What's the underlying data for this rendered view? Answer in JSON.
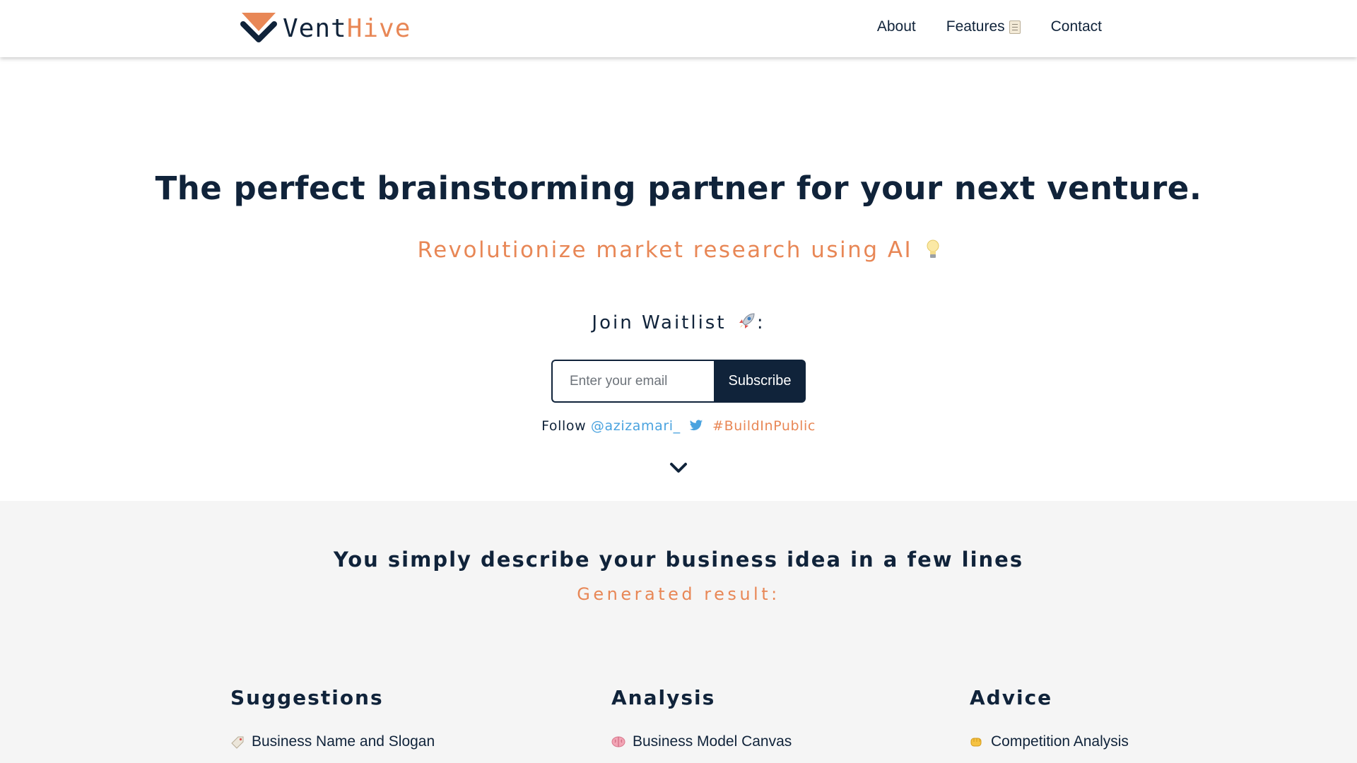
{
  "brand": {
    "name_part1": "Vent",
    "name_part2": "Hive",
    "primary_color": "#10233a",
    "accent_color": "#e88756"
  },
  "nav": {
    "items": [
      {
        "label": "About"
      },
      {
        "label": "Features",
        "icon": "memo-icon"
      },
      {
        "label": "Contact"
      }
    ]
  },
  "hero": {
    "title": "The perfect brainstorming partner for your next venture.",
    "subtitle": "Revolutionize market research using AI",
    "subtitle_icon": "light-bulb-icon",
    "waitlist_label": "Join Waitlist",
    "waitlist_icon": "rocket-icon",
    "waitlist_suffix": ":"
  },
  "form": {
    "email_placeholder": "Enter your email",
    "email_value": "",
    "subscribe_label": "Subscribe"
  },
  "follow": {
    "prefix": "Follow",
    "handle": "@azizamari_",
    "hashtag": "#BuildInPublic",
    "twitter_color": "#4aa3df"
  },
  "section": {
    "title": "You simply describe your business idea in a few lines",
    "subtitle": "Generated result:",
    "columns": [
      {
        "heading": "Suggestions",
        "items": [
          {
            "label": "Business Name and Slogan",
            "icon": "label-tag-icon"
          }
        ]
      },
      {
        "heading": "Analysis",
        "items": [
          {
            "label": "Business Model Canvas",
            "icon": "brain-icon"
          }
        ]
      },
      {
        "heading": "Advice",
        "items": [
          {
            "label": "Competition Analysis",
            "icon": "fist-bump-icon"
          }
        ]
      }
    ]
  }
}
